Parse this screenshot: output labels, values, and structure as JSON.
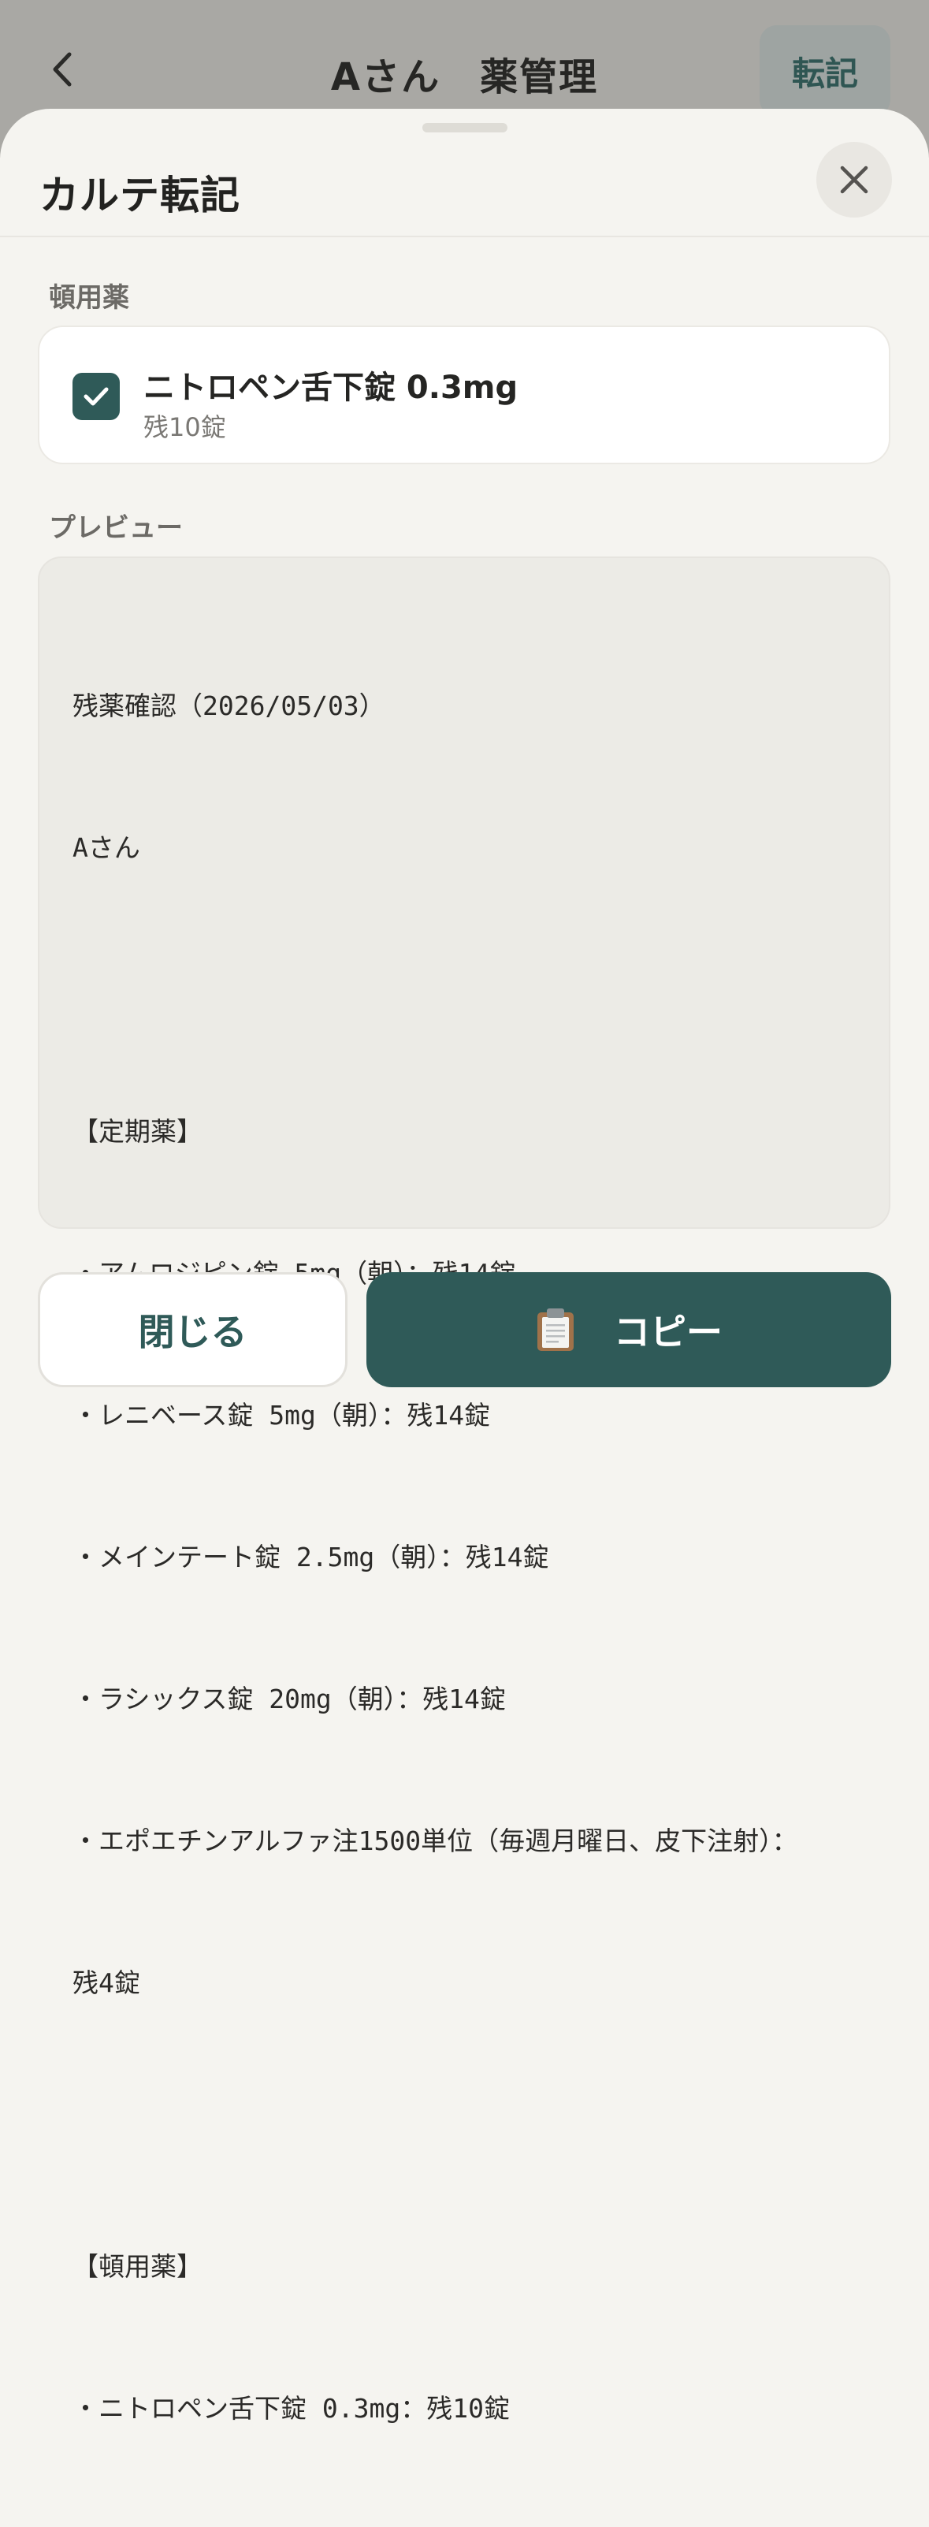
{
  "background_header": {
    "title": "Aさん　薬管理",
    "action_label": "転記"
  },
  "sheet": {
    "title": "カルテ転記"
  },
  "prn_section": {
    "label": "頓用薬",
    "items": [
      {
        "name": "ニトロペン舌下錠 0.3mg",
        "remaining": "残10錠",
        "checked": true
      }
    ]
  },
  "preview_section": {
    "label": "プレビュー",
    "lines": [
      "残薬確認（2026/05/03）",
      "Aさん",
      "",
      "【定期薬】",
      "・アムロジピン錠 5mg（朝）：残14錠",
      "・レニベース錠 5mg（朝）：残14錠",
      "・メインテート錠 2.5mg（朝）：残14錠",
      "・ラシックス錠 20mg（朝）：残14錠",
      "・エポエチンアルファ注1500単位（毎週月曜日、皮下注射）：",
      "残4錠",
      "",
      "【頓用薬】",
      "・ニトロペン舌下錠 0.3mg：残10錠"
    ]
  },
  "footer": {
    "close_label": "閉じる",
    "copy_label": "コピー",
    "copy_icon": "clipboard-icon"
  },
  "colors": {
    "accent": "#2f5a58",
    "background": "#f5f4f0",
    "preview_bg": "#ecebe6"
  }
}
